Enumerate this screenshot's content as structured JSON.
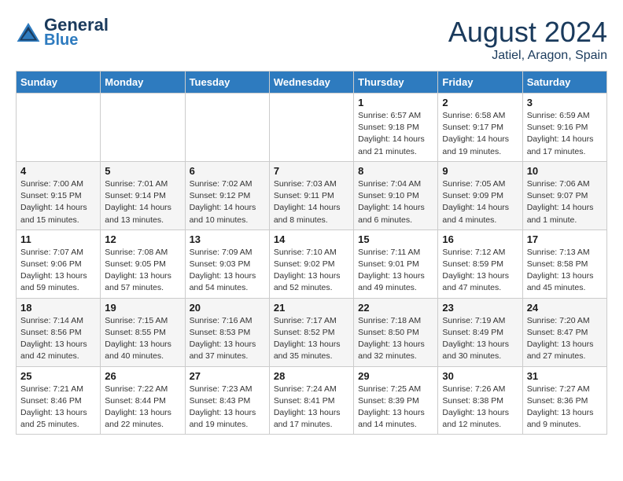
{
  "header": {
    "logo_line1": "General",
    "logo_line2": "Blue",
    "month_year": "August 2024",
    "location": "Jatiel, Aragon, Spain"
  },
  "days_of_week": [
    "Sunday",
    "Monday",
    "Tuesday",
    "Wednesday",
    "Thursday",
    "Friday",
    "Saturday"
  ],
  "weeks": [
    [
      {
        "day": "",
        "info": ""
      },
      {
        "day": "",
        "info": ""
      },
      {
        "day": "",
        "info": ""
      },
      {
        "day": "",
        "info": ""
      },
      {
        "day": "1",
        "info": "Sunrise: 6:57 AM\nSunset: 9:18 PM\nDaylight: 14 hours\nand 21 minutes."
      },
      {
        "day": "2",
        "info": "Sunrise: 6:58 AM\nSunset: 9:17 PM\nDaylight: 14 hours\nand 19 minutes."
      },
      {
        "day": "3",
        "info": "Sunrise: 6:59 AM\nSunset: 9:16 PM\nDaylight: 14 hours\nand 17 minutes."
      }
    ],
    [
      {
        "day": "4",
        "info": "Sunrise: 7:00 AM\nSunset: 9:15 PM\nDaylight: 14 hours\nand 15 minutes."
      },
      {
        "day": "5",
        "info": "Sunrise: 7:01 AM\nSunset: 9:14 PM\nDaylight: 14 hours\nand 13 minutes."
      },
      {
        "day": "6",
        "info": "Sunrise: 7:02 AM\nSunset: 9:12 PM\nDaylight: 14 hours\nand 10 minutes."
      },
      {
        "day": "7",
        "info": "Sunrise: 7:03 AM\nSunset: 9:11 PM\nDaylight: 14 hours\nand 8 minutes."
      },
      {
        "day": "8",
        "info": "Sunrise: 7:04 AM\nSunset: 9:10 PM\nDaylight: 14 hours\nand 6 minutes."
      },
      {
        "day": "9",
        "info": "Sunrise: 7:05 AM\nSunset: 9:09 PM\nDaylight: 14 hours\nand 4 minutes."
      },
      {
        "day": "10",
        "info": "Sunrise: 7:06 AM\nSunset: 9:07 PM\nDaylight: 14 hours\nand 1 minute."
      }
    ],
    [
      {
        "day": "11",
        "info": "Sunrise: 7:07 AM\nSunset: 9:06 PM\nDaylight: 13 hours\nand 59 minutes."
      },
      {
        "day": "12",
        "info": "Sunrise: 7:08 AM\nSunset: 9:05 PM\nDaylight: 13 hours\nand 57 minutes."
      },
      {
        "day": "13",
        "info": "Sunrise: 7:09 AM\nSunset: 9:03 PM\nDaylight: 13 hours\nand 54 minutes."
      },
      {
        "day": "14",
        "info": "Sunrise: 7:10 AM\nSunset: 9:02 PM\nDaylight: 13 hours\nand 52 minutes."
      },
      {
        "day": "15",
        "info": "Sunrise: 7:11 AM\nSunset: 9:01 PM\nDaylight: 13 hours\nand 49 minutes."
      },
      {
        "day": "16",
        "info": "Sunrise: 7:12 AM\nSunset: 8:59 PM\nDaylight: 13 hours\nand 47 minutes."
      },
      {
        "day": "17",
        "info": "Sunrise: 7:13 AM\nSunset: 8:58 PM\nDaylight: 13 hours\nand 45 minutes."
      }
    ],
    [
      {
        "day": "18",
        "info": "Sunrise: 7:14 AM\nSunset: 8:56 PM\nDaylight: 13 hours\nand 42 minutes."
      },
      {
        "day": "19",
        "info": "Sunrise: 7:15 AM\nSunset: 8:55 PM\nDaylight: 13 hours\nand 40 minutes."
      },
      {
        "day": "20",
        "info": "Sunrise: 7:16 AM\nSunset: 8:53 PM\nDaylight: 13 hours\nand 37 minutes."
      },
      {
        "day": "21",
        "info": "Sunrise: 7:17 AM\nSunset: 8:52 PM\nDaylight: 13 hours\nand 35 minutes."
      },
      {
        "day": "22",
        "info": "Sunrise: 7:18 AM\nSunset: 8:50 PM\nDaylight: 13 hours\nand 32 minutes."
      },
      {
        "day": "23",
        "info": "Sunrise: 7:19 AM\nSunset: 8:49 PM\nDaylight: 13 hours\nand 30 minutes."
      },
      {
        "day": "24",
        "info": "Sunrise: 7:20 AM\nSunset: 8:47 PM\nDaylight: 13 hours\nand 27 minutes."
      }
    ],
    [
      {
        "day": "25",
        "info": "Sunrise: 7:21 AM\nSunset: 8:46 PM\nDaylight: 13 hours\nand 25 minutes."
      },
      {
        "day": "26",
        "info": "Sunrise: 7:22 AM\nSunset: 8:44 PM\nDaylight: 13 hours\nand 22 minutes."
      },
      {
        "day": "27",
        "info": "Sunrise: 7:23 AM\nSunset: 8:43 PM\nDaylight: 13 hours\nand 19 minutes."
      },
      {
        "day": "28",
        "info": "Sunrise: 7:24 AM\nSunset: 8:41 PM\nDaylight: 13 hours\nand 17 minutes."
      },
      {
        "day": "29",
        "info": "Sunrise: 7:25 AM\nSunset: 8:39 PM\nDaylight: 13 hours\nand 14 minutes."
      },
      {
        "day": "30",
        "info": "Sunrise: 7:26 AM\nSunset: 8:38 PM\nDaylight: 13 hours\nand 12 minutes."
      },
      {
        "day": "31",
        "info": "Sunrise: 7:27 AM\nSunset: 8:36 PM\nDaylight: 13 hours\nand 9 minutes."
      }
    ]
  ]
}
